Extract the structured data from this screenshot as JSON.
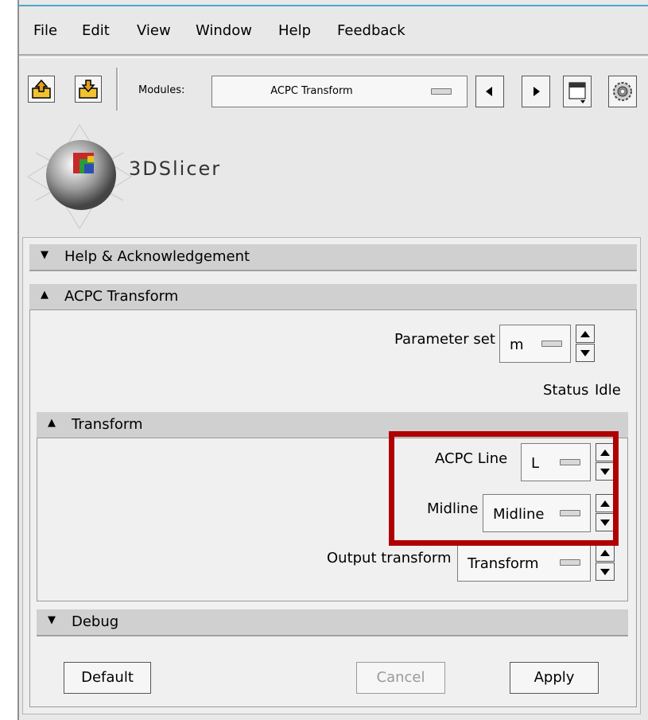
{
  "menu": [
    {
      "label": "File"
    },
    {
      "label": "Edit"
    },
    {
      "label": "View"
    },
    {
      "label": "Window"
    },
    {
      "label": "Help"
    },
    {
      "label": "Feedback"
    }
  ],
  "toolbar": {
    "modules_label": "Modules:",
    "module_selected": "ACPC Transform",
    "icons": [
      "load-data-icon",
      "save-data-icon",
      "prev-module-icon",
      "next-module-icon",
      "layout-icon",
      "settings-icon"
    ]
  },
  "logo": {
    "text": "3DSlicer"
  },
  "sections": {
    "help": "Help & Acknowledgement",
    "acpc": "ACPC Transform",
    "transform": "Transform",
    "debug": "Debug"
  },
  "parameter_set": {
    "label": "Parameter set",
    "value": "m"
  },
  "status": {
    "label": "Status",
    "value": "Idle"
  },
  "fields": {
    "acpc_line": {
      "label": "ACPC Line",
      "value": "L"
    },
    "midline": {
      "label": "Midline",
      "value": "Midline"
    },
    "output_transform": {
      "label": "Output transform",
      "value": "Transform"
    }
  },
  "buttons": {
    "default": "Default",
    "cancel": "Cancel",
    "apply": "Apply"
  },
  "colors": {
    "highlight": "#b00000",
    "window_accent": "#4aa8c8"
  }
}
